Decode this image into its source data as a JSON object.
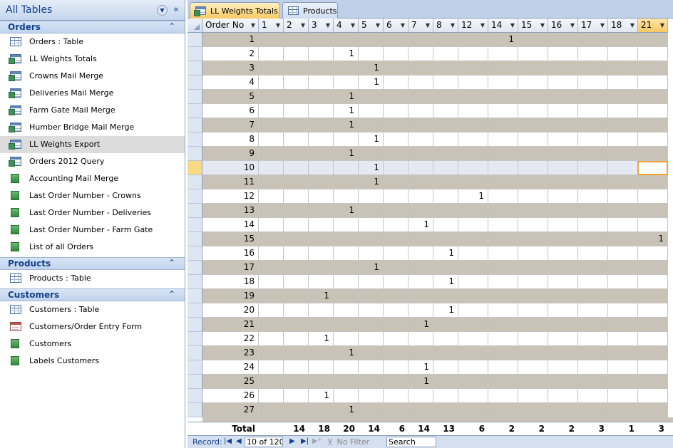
{
  "nav": {
    "title": "All Tables",
    "groups": [
      {
        "title": "Orders",
        "items": [
          {
            "label": "Orders : Table",
            "icon": "table-icon"
          },
          {
            "label": "LL Weights Totals",
            "icon": "crosstab-query-icon"
          },
          {
            "label": "Crowns Mail Merge",
            "icon": "query-icon"
          },
          {
            "label": "Deliveries Mail Merge",
            "icon": "query-icon"
          },
          {
            "label": "Farm Gate Mail Merge",
            "icon": "query-icon"
          },
          {
            "label": "Humber Bridge Mail Merge",
            "icon": "query-icon"
          },
          {
            "label": "LL Weights Export",
            "icon": "query-icon",
            "selected": true
          },
          {
            "label": "Orders 2012 Query",
            "icon": "query-icon"
          },
          {
            "label": "Accounting Mail Merge",
            "icon": "report-icon"
          },
          {
            "label": "Last Order Number - Crowns",
            "icon": "report-icon"
          },
          {
            "label": "Last Order Number - Deliveries",
            "icon": "report-icon"
          },
          {
            "label": "Last Order Number - Farm Gate",
            "icon": "report-icon"
          },
          {
            "label": "List of all Orders",
            "icon": "report-icon"
          }
        ]
      },
      {
        "title": "Products",
        "items": [
          {
            "label": "Products : Table",
            "icon": "table-icon"
          }
        ]
      },
      {
        "title": "Customers",
        "items": [
          {
            "label": "Customers : Table",
            "icon": "table-icon"
          },
          {
            "label": "Customers/Order Entry Form",
            "icon": "form-icon"
          },
          {
            "label": "Customers",
            "icon": "report-icon"
          },
          {
            "label": "Labels Customers",
            "icon": "report-icon"
          }
        ]
      }
    ]
  },
  "tabs": [
    {
      "label": "LL Weights Totals",
      "active": true
    },
    {
      "label": "Products",
      "active": false
    }
  ],
  "sheet": {
    "columns": [
      "Order No",
      "1",
      "2",
      "3",
      "4",
      "5",
      "6",
      "7",
      "8",
      "12",
      "14",
      "15",
      "16",
      "17",
      "18",
      "21"
    ],
    "selected_column": "21",
    "current_order": 10,
    "rows": [
      {
        "order": "1",
        "values": {
          "14": "1"
        }
      },
      {
        "order": "2",
        "values": {
          "4": "1"
        }
      },
      {
        "order": "3",
        "values": {
          "5": "1"
        }
      },
      {
        "order": "4",
        "values": {
          "5": "1"
        }
      },
      {
        "order": "5",
        "values": {
          "4": "1"
        }
      },
      {
        "order": "6",
        "values": {
          "4": "1"
        }
      },
      {
        "order": "7",
        "values": {
          "4": "1"
        }
      },
      {
        "order": "8",
        "values": {
          "5": "1"
        }
      },
      {
        "order": "9",
        "values": {
          "4": "1"
        }
      },
      {
        "order": "10",
        "values": {
          "5": "1"
        }
      },
      {
        "order": "11",
        "values": {
          "5": "1"
        }
      },
      {
        "order": "12",
        "values": {
          "12": "1"
        }
      },
      {
        "order": "13",
        "values": {
          "4": "1"
        }
      },
      {
        "order": "14",
        "values": {
          "7": "1"
        }
      },
      {
        "order": "15",
        "values": {
          "21": "1"
        }
      },
      {
        "order": "16",
        "values": {
          "8": "1"
        }
      },
      {
        "order": "17",
        "values": {
          "5": "1"
        }
      },
      {
        "order": "18",
        "values": {
          "8": "1"
        }
      },
      {
        "order": "19",
        "values": {
          "3": "1"
        }
      },
      {
        "order": "20",
        "values": {
          "8": "1"
        }
      },
      {
        "order": "21",
        "values": {
          "7": "1"
        }
      },
      {
        "order": "22",
        "values": {
          "3": "1"
        }
      },
      {
        "order": "23",
        "values": {
          "4": "1"
        }
      },
      {
        "order": "24",
        "values": {
          "7": "1"
        }
      },
      {
        "order": "25",
        "values": {
          "7": "1"
        }
      },
      {
        "order": "26",
        "values": {
          "3": "1"
        }
      },
      {
        "order": "27",
        "values": {
          "4": "1"
        }
      }
    ],
    "total_label": "Total",
    "totals": {
      "1": "",
      "2": "14",
      "3": "18",
      "4": "20",
      "5": "14",
      "6": "6",
      "7": "14",
      "8": "13",
      "12": "6",
      "14": "2",
      "15": "2",
      "16": "2",
      "17": "3",
      "18": "1",
      "21": "3"
    }
  },
  "recbar": {
    "label": "Record:",
    "current": "10 of 120",
    "filter": "No Filter",
    "search": "Search"
  }
}
